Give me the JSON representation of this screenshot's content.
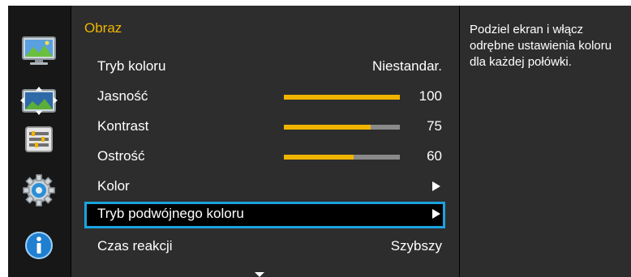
{
  "menu": {
    "title": "Obraz",
    "items": [
      {
        "label": "Tryb koloru",
        "value": "Niestandar."
      },
      {
        "label": "Jasność",
        "value": "100",
        "level": 1.0
      },
      {
        "label": "Kontrast",
        "value": "75",
        "level": 0.75
      },
      {
        "label": "Ostrość",
        "value": "60",
        "level": 0.6
      },
      {
        "label": "Kolor"
      },
      {
        "label": "Tryb podwójnego koloru",
        "selected": true
      },
      {
        "label": "Czas reakcji",
        "value": "Szybszy"
      }
    ]
  },
  "help_text": "Podziel ekran i włącz odrębne ustawienia koloru dla każdej połówki.",
  "sidebar": {
    "icons": [
      "picture-icon",
      "position-size-icon",
      "system-settings-icon",
      "gear-icon",
      "information-icon"
    ]
  },
  "colors": {
    "accent": "#f0b400",
    "highlight": "#1aa3df",
    "panel": "#2d2d2d"
  }
}
